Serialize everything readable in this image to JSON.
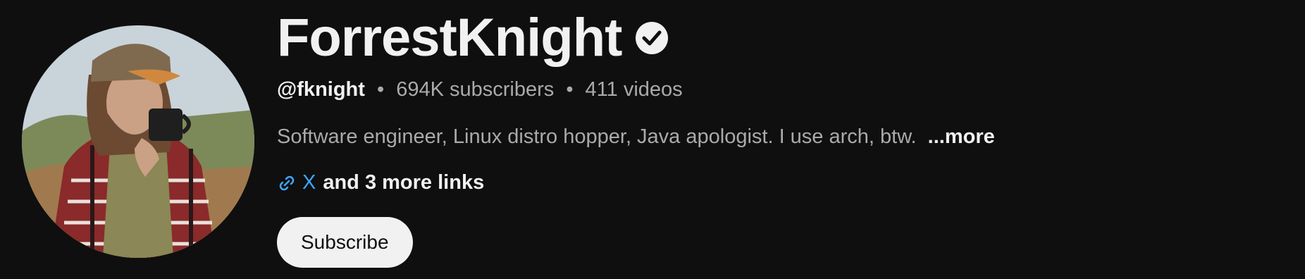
{
  "channel": {
    "name": "ForrestKnight",
    "handle": "@fknight",
    "separator": "•",
    "subscribers": "694K subscribers",
    "videos": "411 videos",
    "description": "Software engineer, Linux distro hopper, Java apologist. I use arch, btw.",
    "more_label": "...more",
    "primary_link": "X",
    "more_links": "and 3 more links",
    "subscribe_label": "Subscribe"
  },
  "icons": {
    "verified": "verified-check-icon",
    "link": "link-icon"
  },
  "colors": {
    "background": "#0f0f0f",
    "text_primary": "#f1f1f1",
    "text_secondary": "#aaaaaa",
    "link": "#3ea6ff",
    "subscribe_bg": "#f1f1f1"
  }
}
